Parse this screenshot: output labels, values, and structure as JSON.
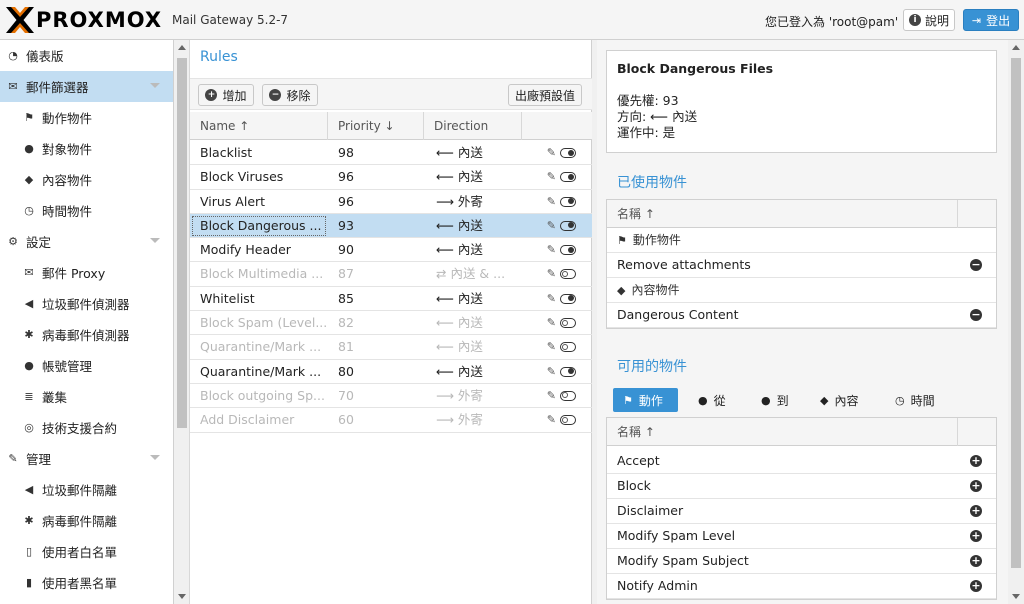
{
  "header": {
    "logo_text": "PROXMOX",
    "version": "Mail Gateway 5.2-7",
    "login_info": "您已登入為 'root@pam'",
    "help_label": "說明",
    "logout_label": "登出"
  },
  "sidebar": {
    "items": [
      {
        "label": "儀表版",
        "icon": "dashboard-icon",
        "glyph": "◔",
        "level": 0
      },
      {
        "label": "郵件篩選器",
        "icon": "envelope-icon",
        "glyph": "✉",
        "level": 0,
        "selected": true,
        "caret": true
      },
      {
        "label": "動作物件",
        "icon": "flag-icon",
        "glyph": "⚑",
        "level": 1
      },
      {
        "label": "對象物件",
        "icon": "user-icon",
        "glyph": "●",
        "level": 1
      },
      {
        "label": "內容物件",
        "icon": "cube-icon",
        "glyph": "◆",
        "level": 1
      },
      {
        "label": "時間物件",
        "icon": "clock-icon",
        "glyph": "◷",
        "level": 1
      },
      {
        "label": "設定",
        "icon": "gears-icon",
        "glyph": "⚙",
        "level": 0,
        "caret": true
      },
      {
        "label": "郵件 Proxy",
        "icon": "envelope-o-icon",
        "glyph": "✉",
        "level": 1
      },
      {
        "label": "垃圾郵件偵測器",
        "icon": "bullhorn-icon",
        "glyph": "◀",
        "level": 1
      },
      {
        "label": "病毒郵件偵測器",
        "icon": "bug-icon",
        "glyph": "✱",
        "level": 1
      },
      {
        "label": "帳號管理",
        "icon": "users-icon",
        "glyph": "●",
        "level": 1
      },
      {
        "label": "叢集",
        "icon": "server-icon",
        "glyph": "≣",
        "level": 1
      },
      {
        "label": "技術支援合約",
        "icon": "lifebuoy-icon",
        "glyph": "◎",
        "level": 1
      },
      {
        "label": "管理",
        "icon": "wrench-icon",
        "glyph": "✎",
        "level": 0,
        "caret": true
      },
      {
        "label": "垃圾郵件隔離",
        "icon": "bullhorn-icon",
        "glyph": "◀",
        "level": 1
      },
      {
        "label": "病毒郵件隔離",
        "icon": "bug-icon",
        "glyph": "✱",
        "level": 1
      },
      {
        "label": "使用者白名單",
        "icon": "file-o-icon",
        "glyph": "▯",
        "level": 1
      },
      {
        "label": "使用者黑名單",
        "icon": "file-icon",
        "glyph": "▮",
        "level": 1
      }
    ]
  },
  "rules": {
    "title": "Rules",
    "add_label": "增加",
    "remove_label": "移除",
    "defaults_label": "出廠預設值",
    "columns": {
      "name": "Name ↑",
      "priority": "Priority ↓",
      "direction": "Direction"
    },
    "rows": [
      {
        "name": "Blacklist",
        "priority": "98",
        "direction": "⟵ 內送",
        "enabled": true
      },
      {
        "name": "Block Viruses",
        "priority": "96",
        "direction": "⟵ 內送",
        "enabled": true
      },
      {
        "name": "Virus Alert",
        "priority": "96",
        "direction": "⟶ 外寄",
        "enabled": true
      },
      {
        "name": "Block Dangerous ...",
        "priority": "93",
        "direction": "⟵ 內送",
        "enabled": true,
        "selected": true
      },
      {
        "name": "Modify Header",
        "priority": "90",
        "direction": "⟵ 內送",
        "enabled": true
      },
      {
        "name": "Block Multimedia ...",
        "priority": "87",
        "direction": "⇄ 內送 & ...",
        "enabled": false
      },
      {
        "name": "Whitelist",
        "priority": "85",
        "direction": "⟵ 內送",
        "enabled": true
      },
      {
        "name": "Block Spam (Level...",
        "priority": "82",
        "direction": "⟵ 內送",
        "enabled": false
      },
      {
        "name": "Quarantine/Mark ...",
        "priority": "81",
        "direction": "⟵ 內送",
        "enabled": false
      },
      {
        "name": "Quarantine/Mark ...",
        "priority": "80",
        "direction": "⟵ 內送",
        "enabled": true
      },
      {
        "name": "Block outgoing Sp...",
        "priority": "70",
        "direction": "⟶ 外寄",
        "enabled": false
      },
      {
        "name": "Add Disclaimer",
        "priority": "60",
        "direction": "⟶ 外寄",
        "enabled": false
      }
    ]
  },
  "detail": {
    "title": "Block Dangerous Files",
    "priority_line": "優先權: 93",
    "direction_line": "方向: ⟵ 內送",
    "active_line": "運作中: 是"
  },
  "used_objects": {
    "title": "已使用物件",
    "col_name": "名稱 ↑",
    "groups": [
      {
        "label": "動作物件",
        "icon": "flag-icon",
        "glyph": "⚑",
        "items": [
          "Remove attachments"
        ]
      },
      {
        "label": "內容物件",
        "icon": "cube-icon",
        "glyph": "◆",
        "items": [
          "Dangerous Content"
        ]
      }
    ]
  },
  "available_objects": {
    "title": "可用的物件",
    "filters": [
      {
        "label": "動作",
        "icon": "flag-icon",
        "active": true
      },
      {
        "label": "從",
        "icon": "user-icon"
      },
      {
        "label": "到",
        "icon": "user-icon"
      },
      {
        "label": "內容",
        "icon": "cube-icon"
      },
      {
        "label": "時間",
        "icon": "clock-icon"
      }
    ],
    "col_name": "名稱 ↑",
    "items": [
      "Accept",
      "Block",
      "Disclaimer",
      "Modify Spam Level",
      "Modify Spam Subject",
      "Notify Admin"
    ]
  },
  "colors": {
    "accent": "#3892d4",
    "selected": "#c2ddf2"
  }
}
